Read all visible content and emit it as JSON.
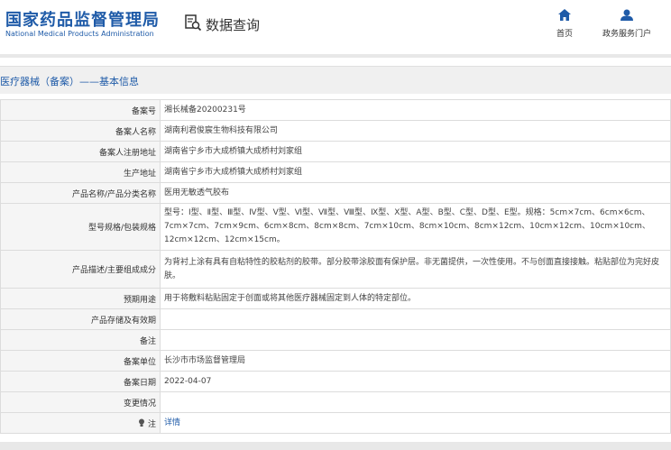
{
  "header": {
    "logo_cn": "国家药品监督管理局",
    "logo_en": "National Medical Products Administration",
    "query_label": "数据查询",
    "nav": [
      {
        "label": "首页",
        "icon": "home-icon"
      },
      {
        "label": "政务服务门户",
        "icon": "user-icon"
      }
    ]
  },
  "breadcrumb": "医疗器械（备案）——基本信息",
  "rows": [
    {
      "label": "备案号",
      "value": "湘长械备20200231号"
    },
    {
      "label": "备案人名称",
      "value": "湖南利君俊宸生物科技有限公司"
    },
    {
      "label": "备案人注册地址",
      "value": "湖南省宁乡市大成桥镇大成桥村刘家组"
    },
    {
      "label": "生产地址",
      "value": "湖南省宁乡市大成桥镇大成桥村刘家组"
    },
    {
      "label": "产品名称/产品分类名称",
      "value": "医用无敏透气胶布"
    },
    {
      "label": "型号规格/包装规格",
      "value": "型号：Ⅰ型、Ⅱ型、Ⅲ型、Ⅳ型、Ⅴ型、Ⅵ型、Ⅶ型、Ⅷ型、Ⅸ型、Ⅹ型、A型、B型、C型、D型、E型。规格：5cm×7cm、6cm×6cm、7cm×7cm、7cm×9cm、6cm×8cm、8cm×8cm、7cm×10cm、8cm×10cm、8cm×12cm、10cm×12cm、10cm×10cm、12cm×12cm、12cm×15cm。"
    },
    {
      "label": "产品描述/主要组成成分",
      "value": "为背衬上涂有具有自粘特性的胶粘剂的胶带。部分胶带涂胶面有保护层。非无菌提供，一次性使用。不与创面直接接触。粘贴部位为完好皮肤。"
    },
    {
      "label": "预期用途",
      "value": "用于将敷料粘贴固定于创面或将其他医疗器械固定到人体的特定部位。"
    },
    {
      "label": "产品存储及有效期",
      "value": ""
    },
    {
      "label": "备注",
      "value": ""
    },
    {
      "label": "备案单位",
      "value": "长沙市市场监督管理局"
    },
    {
      "label": "备案日期",
      "value": "2022-04-07"
    },
    {
      "label": "变更情况",
      "value": ""
    },
    {
      "label": "注",
      "value": "详情",
      "link": true
    }
  ],
  "colors": {
    "brand": "#1f5ba8",
    "label_bg": "#f5f5f5"
  }
}
